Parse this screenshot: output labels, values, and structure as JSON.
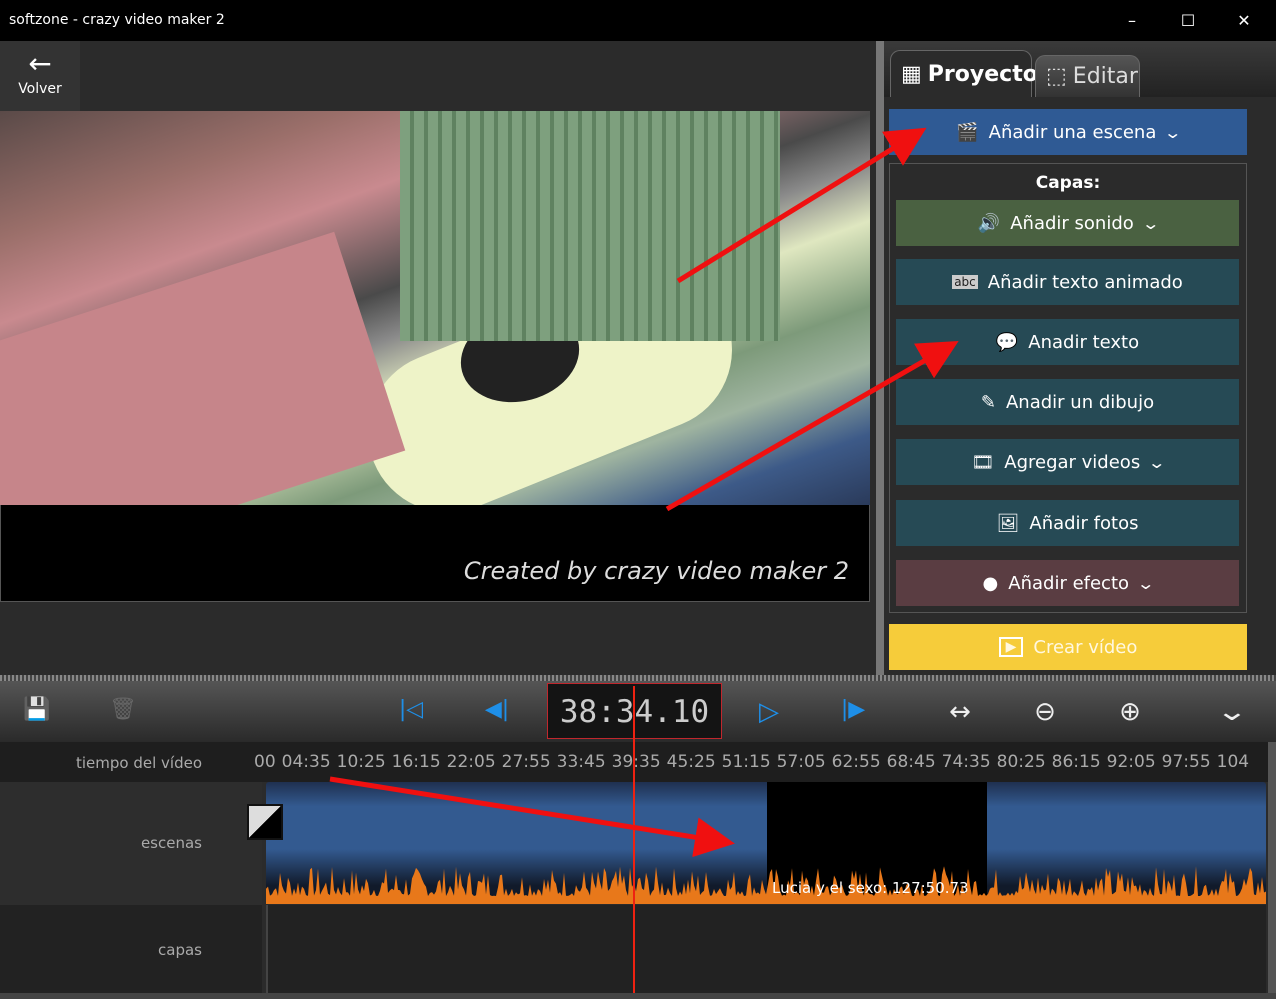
{
  "window": {
    "title": "softzone - crazy video maker 2",
    "minimize": "–",
    "maximize": "☐",
    "close": "✕"
  },
  "nav": {
    "back_icon": "←",
    "back_label": "Volver"
  },
  "preview": {
    "caption": "Created by crazy video maker 2"
  },
  "tabs": [
    {
      "label": "Proyecto",
      "icon": "▦"
    },
    {
      "label": "Editar",
      "icon": "⬚"
    }
  ],
  "panel": {
    "add_scene": {
      "label": "Añadir una escena",
      "icon": "🎬",
      "color": "#2f5a94"
    },
    "capas_title": "Capas:",
    "buttons": [
      {
        "label": "Añadir sonido",
        "icon": "🔊",
        "dropdown": true,
        "color": "#4a6141"
      },
      {
        "label": "Añadir texto animado",
        "icon": "abc",
        "dropdown": false,
        "color": "#264a55"
      },
      {
        "label": "Anadir texto",
        "icon": "💬",
        "dropdown": false,
        "color": "#264a55"
      },
      {
        "label": "Anadir un dibujo",
        "icon": "✎",
        "dropdown": false,
        "color": "#264a55"
      },
      {
        "label": "Agregar videos",
        "icon": "🎞",
        "dropdown": true,
        "color": "#264a55"
      },
      {
        "label": "Añadir fotos",
        "icon": "🖼",
        "dropdown": false,
        "color": "#264a55"
      },
      {
        "label": "Añadir efecto",
        "icon": "●",
        "dropdown": true,
        "color": "#5a3d42"
      }
    ],
    "create": {
      "label": "Crear vídeo",
      "icon": "▶",
      "color": "#f6cc3a"
    },
    "chevron": "⌄"
  },
  "toolbar": {
    "timecode": "38:34.10",
    "save_icon": "💾",
    "delete_icon": "🗑",
    "first_icon": "|◁",
    "prev_icon": "◀|",
    "play_icon": "▷",
    "next_icon": "|▶",
    "fit_icon": "↔",
    "zoom_out_icon": "⊖",
    "zoom_in_icon": "⊕",
    "more_icon": "⌄"
  },
  "timeline": {
    "time_label": "tiempo del vídeo",
    "ticks": [
      "00",
      "04:35",
      "10:25",
      "16:15",
      "22:05",
      "27:55",
      "33:45",
      "39:35",
      "45:25",
      "51:15",
      "57:05",
      "62:55",
      "68:45",
      "74:35",
      "80:25",
      "86:15",
      "92:05",
      "97:55",
      "104"
    ],
    "scenes_label": "escenas",
    "layers_label": "capas",
    "clip_label": "Lucia y el sexo: 127:50.73"
  }
}
